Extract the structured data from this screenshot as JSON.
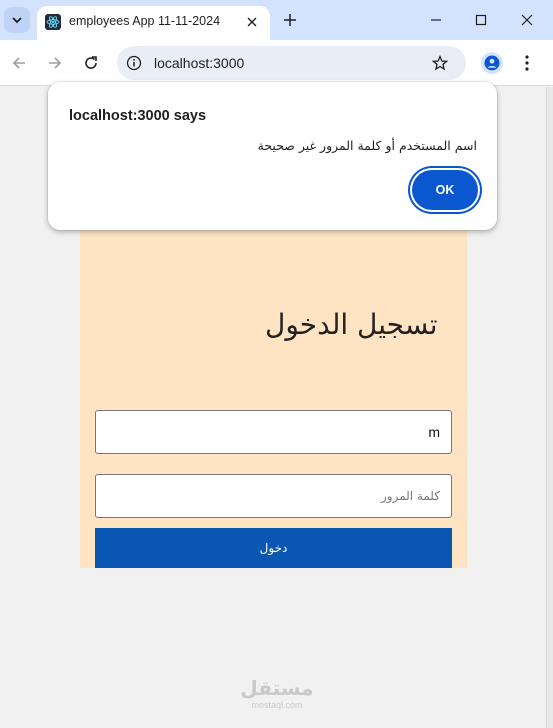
{
  "browser": {
    "tab_title": "employees App 11-11-2024",
    "url": "localhost:3000"
  },
  "dialog": {
    "title": "localhost:3000 says",
    "message": "اسم المستخدم أو كلمة المرور غير صحيحة",
    "ok_label": "OK"
  },
  "login": {
    "title": "تسجيل الدخول",
    "username_value": "m",
    "password_placeholder": "كلمة المرور",
    "submit_label": "دخول"
  },
  "watermark": {
    "main": "مستقل",
    "sub": "mostaql.com"
  },
  "colors": {
    "tab_strip": "#d3e3fd",
    "panel_background": "#ffe4c4",
    "button_blue": "#0a57b1",
    "dialog_ok": "#0b57d0"
  },
  "icons": [
    "tab-search-icon",
    "react-favicon-icon",
    "close-icon",
    "plus-icon",
    "minimize-icon",
    "maximize-icon",
    "window-close-icon",
    "back-arrow-icon",
    "forward-arrow-icon",
    "reload-icon",
    "info-icon",
    "star-icon",
    "profile-icon",
    "kebab-menu-icon"
  ]
}
